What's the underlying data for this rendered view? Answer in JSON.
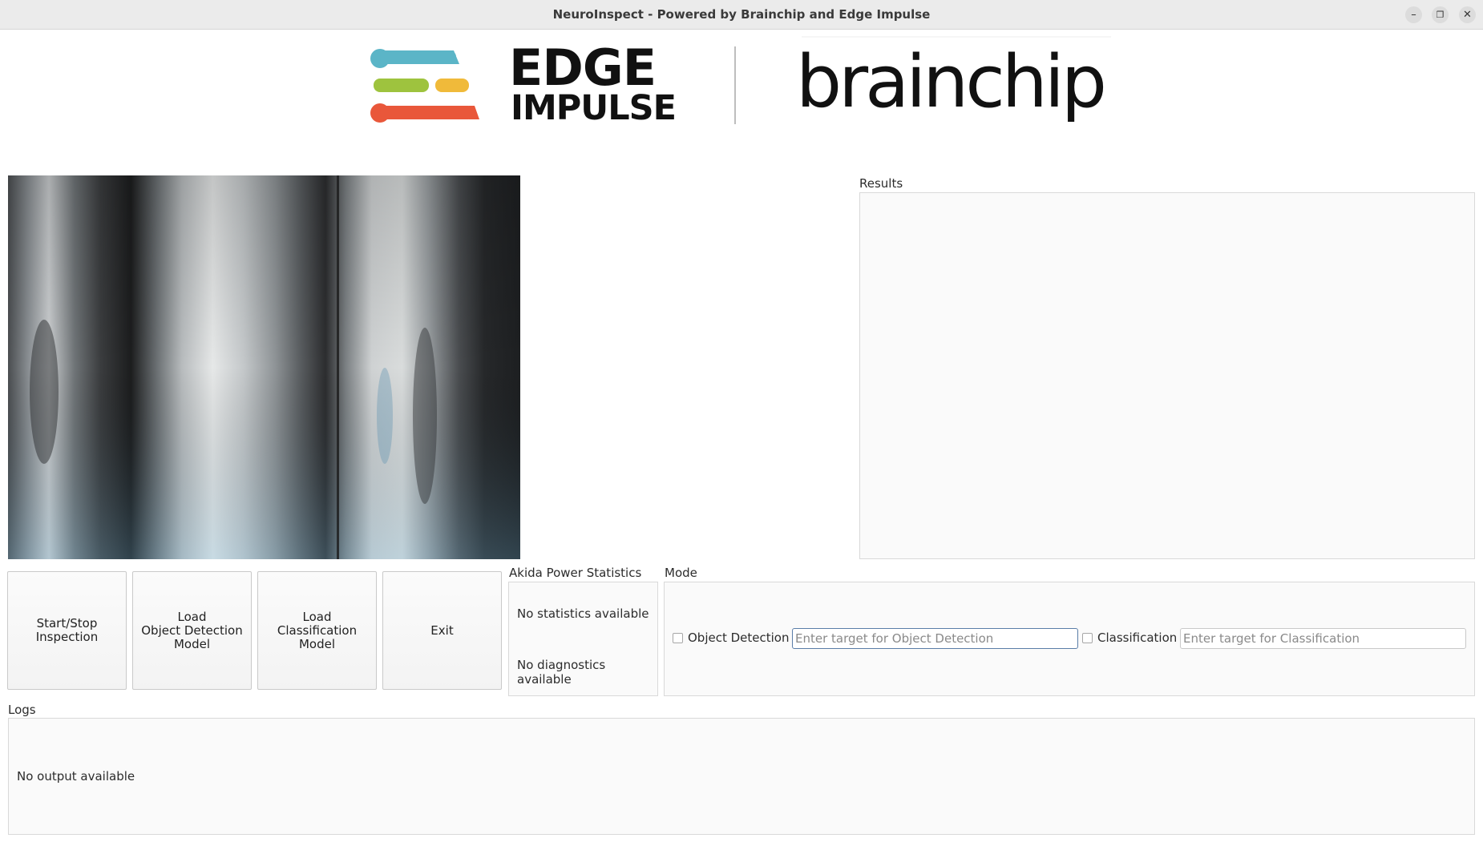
{
  "window": {
    "title": "NeuroInspect - Powered by Brainchip and Edge Impulse"
  },
  "logos": {
    "edge_line1": "EDGE",
    "edge_line2": "IMPULSE",
    "brainchip": "brainchip"
  },
  "results": {
    "label": "Results"
  },
  "buttons": {
    "start_stop": "Start/Stop\nInspection",
    "load_od": "Load\nObject Detection\nModel",
    "load_cls": "Load\nClassification\nModel",
    "exit": "Exit"
  },
  "power": {
    "label": "Akida Power Statistics",
    "stats": "No statistics available",
    "diagnostics": "No diagnostics available"
  },
  "mode": {
    "label": "Mode",
    "od_label": "Object Detection",
    "od_placeholder": "Enter target for Object Detection",
    "cls_label": "Classification",
    "cls_placeholder": "Enter target for Classification"
  },
  "logs": {
    "label": "Logs",
    "output": "No output available"
  },
  "colors": {
    "bar1": "#5bb5c7",
    "bar2": "#9ec33e",
    "bar3": "#f0ba3a",
    "bar4": "#e9573a"
  }
}
